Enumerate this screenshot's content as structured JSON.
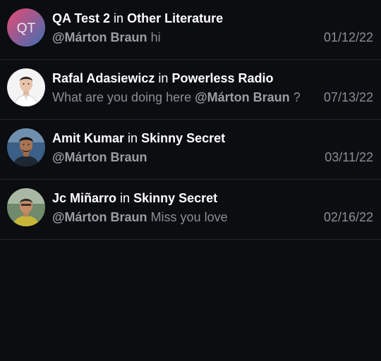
{
  "notifications": [
    {
      "author": "QA Test 2",
      "connector": "in",
      "channel": "Other Literature",
      "pre_text": "",
      "mention": "@Márton Braun",
      "post_text": " hi",
      "date": "01/12/22",
      "avatar": {
        "type": "initials",
        "initials": "QT",
        "colors": [
          "#e0507a",
          "#3a6fb0"
        ]
      }
    },
    {
      "author": "Rafal Adasiewicz",
      "connector": "in",
      "channel": "Powerless Radio",
      "pre_text": "What are you doing here ",
      "mention": "@Márton Braun",
      "post_text": " ?",
      "date": "07/13/22",
      "avatar": {
        "type": "photo",
        "description": "man-in-white-shirt"
      }
    },
    {
      "author": "Amit Kumar",
      "connector": "in",
      "channel": "Skinny Secret",
      "pre_text": "",
      "mention": "@Márton Braun",
      "post_text": "",
      "date": "03/11/22",
      "avatar": {
        "type": "photo",
        "description": "man-with-dark-hair"
      }
    },
    {
      "author": "Jc Miñarro",
      "connector": "in",
      "channel": "Skinny Secret",
      "pre_text": "",
      "mention": "@Márton Braun",
      "post_text": " Miss you love",
      "date": "02/16/22",
      "avatar": {
        "type": "photo",
        "description": "man-in-yellow-shirt-outdoors"
      }
    }
  ]
}
